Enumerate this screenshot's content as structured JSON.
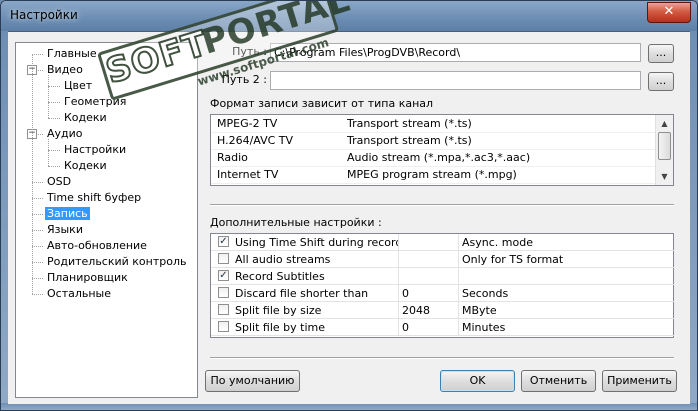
{
  "window": {
    "title": "Настройки",
    "close_glyph": "✕"
  },
  "tree": {
    "items": [
      {
        "label": "Главные"
      },
      {
        "label": "Видео",
        "toggle": "−"
      },
      {
        "label": "Цвет"
      },
      {
        "label": "Геометрия"
      },
      {
        "label": "Кодеки"
      },
      {
        "label": "Аудио",
        "toggle": "−"
      },
      {
        "label": "Настройки"
      },
      {
        "label": "Кодеки"
      },
      {
        "label": "OSD"
      },
      {
        "label": "Time shift буфер"
      },
      {
        "label": "Запись",
        "selected": true
      },
      {
        "label": "Языки"
      },
      {
        "label": "Авто-обновление"
      },
      {
        "label": "Родительский контроль"
      },
      {
        "label": "Планировщик"
      },
      {
        "label": "Остальные"
      }
    ]
  },
  "record": {
    "path_label": "Путь :",
    "path_value": "C:\\Program Files\\ProgDVB\\Record\\",
    "path2_label": "Путь 2 :",
    "path2_value": "",
    "browse_label": "...",
    "format_label": "Формат записи зависит от типа канал",
    "formats": [
      {
        "type": "MPEG-2 TV",
        "format": "Transport stream (*.ts)"
      },
      {
        "type": "H.264/AVC TV",
        "format": "Transport stream (*.ts)"
      },
      {
        "type": "Radio",
        "format": "Audio stream (*.mpa,*.ac3,*.aac)"
      },
      {
        "type": "Internet TV",
        "format": "MPEG program stream (*.mpg)"
      }
    ],
    "advanced_label": "Дополнительные настройки :",
    "options": [
      {
        "checked": true,
        "name": "Using Time Shift during record",
        "value": "",
        "extra": "Async. mode"
      },
      {
        "checked": false,
        "name": "All audio streams",
        "value": "",
        "extra": "Only for TS format"
      },
      {
        "checked": true,
        "name": "Record Subtitles",
        "value": "",
        "extra": ""
      },
      {
        "checked": false,
        "name": "Discard file shorter than",
        "value": "0",
        "extra": "Seconds"
      },
      {
        "checked": false,
        "name": "Split file by size",
        "value": "2048",
        "extra": "MByte"
      },
      {
        "checked": false,
        "name": "Split file by time",
        "value": "0",
        "extra": "Minutes"
      }
    ]
  },
  "buttons": {
    "defaults": "По умолчанию",
    "ok": "OK",
    "cancel": "Отменить",
    "apply": "Применить"
  },
  "watermark": {
    "brand_left": "SOFT",
    "brand_right": "PORTAL",
    "tm": "TM",
    "url": "www.softportal.com"
  },
  "scroll": {
    "up": "▲",
    "down": "▼"
  },
  "check_glyph": "✓"
}
